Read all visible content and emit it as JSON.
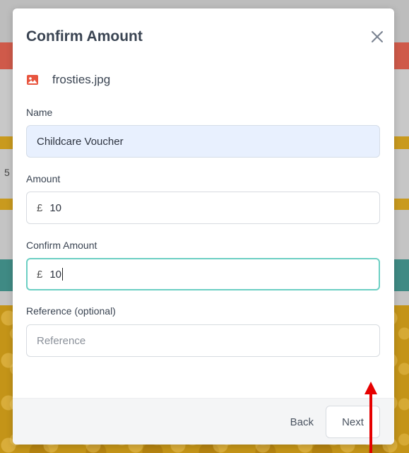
{
  "background": {
    "edge_text": "5"
  },
  "modal": {
    "title": "Confirm Amount",
    "file": {
      "name": "frosties.jpg",
      "icon": "image-icon"
    },
    "fields": {
      "name": {
        "label": "Name",
        "value": "Childcare Voucher"
      },
      "amount": {
        "label": "Amount",
        "currency": "£",
        "value": "10"
      },
      "confirm_amount": {
        "label": "Confirm Amount",
        "currency": "£",
        "value": "10"
      },
      "reference": {
        "label": "Reference (optional)",
        "value": "",
        "placeholder": "Reference"
      }
    },
    "footer": {
      "back_label": "Back",
      "next_label": "Next"
    }
  },
  "colors": {
    "focus_border": "#6ccfc3",
    "autofill_bg": "#e8f0fe",
    "file_icon": "#e8553f",
    "annotation_arrow": "#e60000"
  }
}
